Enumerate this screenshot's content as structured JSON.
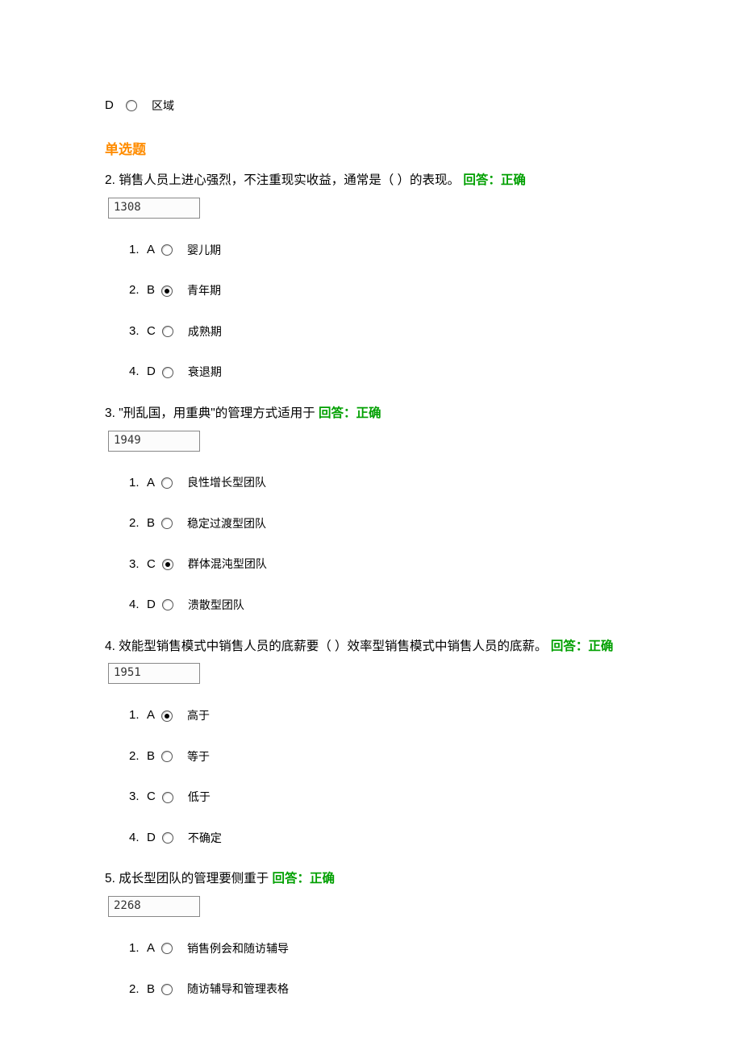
{
  "top_option": {
    "letter": "D",
    "text": "区域",
    "selected": false
  },
  "section_title": "单选题",
  "questions": [
    {
      "num": "2.",
      "stem": "销售人员上进心强烈，不注重现实收益，通常是（ ）的表现。",
      "answer_prefix": "回答：",
      "answer_status": "正确",
      "code": "1308",
      "options": [
        {
          "n": "1.",
          "letter": "A",
          "text": "婴儿期",
          "selected": false
        },
        {
          "n": "2.",
          "letter": "B",
          "text": "青年期",
          "selected": true
        },
        {
          "n": "3.",
          "letter": "C",
          "text": "成熟期",
          "selected": false
        },
        {
          "n": "4.",
          "letter": "D",
          "text": "衰退期",
          "selected": false
        }
      ]
    },
    {
      "num": "3.",
      "stem": "\"刑乱国，用重典\"的管理方式适用于",
      "answer_prefix": "回答：",
      "answer_status": "正确",
      "code": "1949",
      "options": [
        {
          "n": "1.",
          "letter": "A",
          "text": "良性增长型团队",
          "selected": false
        },
        {
          "n": "2.",
          "letter": "B",
          "text": "稳定过渡型团队",
          "selected": false
        },
        {
          "n": "3.",
          "letter": "C",
          "text": "群体混沌型团队",
          "selected": true
        },
        {
          "n": "4.",
          "letter": "D",
          "text": "溃散型团队",
          "selected": false
        }
      ]
    },
    {
      "num": "4.",
      "stem": "效能型销售模式中销售人员的底薪要（ ）效率型销售模式中销售人员的底薪。",
      "answer_prefix": "回答：",
      "answer_status": "正确",
      "code": "1951",
      "options": [
        {
          "n": "1.",
          "letter": "A",
          "text": "高于",
          "selected": true
        },
        {
          "n": "2.",
          "letter": "B",
          "text": "等于",
          "selected": false
        },
        {
          "n": "3.",
          "letter": "C",
          "text": "低于",
          "selected": false
        },
        {
          "n": "4.",
          "letter": "D",
          "text": "不确定",
          "selected": false
        }
      ]
    },
    {
      "num": "5.",
      "stem": "成长型团队的管理要侧重于",
      "answer_prefix": "回答：",
      "answer_status": "正确",
      "code": "2268",
      "options": [
        {
          "n": "1.",
          "letter": "A",
          "text": "销售例会和随访辅导",
          "selected": false
        },
        {
          "n": "2.",
          "letter": "B",
          "text": "随访辅导和管理表格",
          "selected": false
        }
      ]
    }
  ]
}
